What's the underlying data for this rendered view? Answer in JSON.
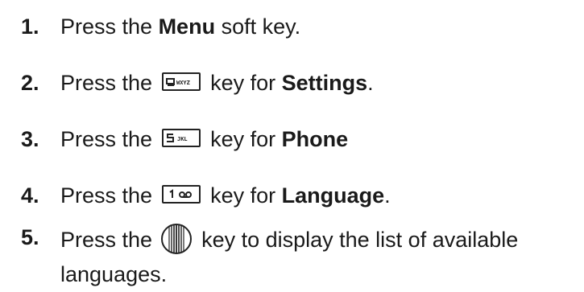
{
  "steps": [
    {
      "num": "1.",
      "pre": "Press the ",
      "bold": "Menu",
      "post": " soft key."
    },
    {
      "num": "2.",
      "pre": "Press the ",
      "key": "9wxyz",
      "mid": " key for ",
      "bold": "Settings",
      "post": "."
    },
    {
      "num": "3.",
      "pre": "Press the ",
      "key": "5jkl",
      "mid": " key for ",
      "bold": "Phone",
      "post": ""
    },
    {
      "num": "4.",
      "pre": "Press the ",
      "key": "1-voicemail",
      "mid": " key for ",
      "bold": "Language",
      "post": "."
    },
    {
      "num": "5.",
      "pre": "Press the ",
      "key": "nav-center",
      "mid": " key to display the list of available",
      "cont": "languages."
    }
  ],
  "icons": {
    "key_9": "9wxyz-key-icon",
    "key_5": "5jkl-key-icon",
    "key_1": "1-voicemail-key-icon",
    "nav": "navigation-key-icon"
  },
  "colors": {
    "text": "#1a1a1a",
    "background": "#ffffff"
  }
}
